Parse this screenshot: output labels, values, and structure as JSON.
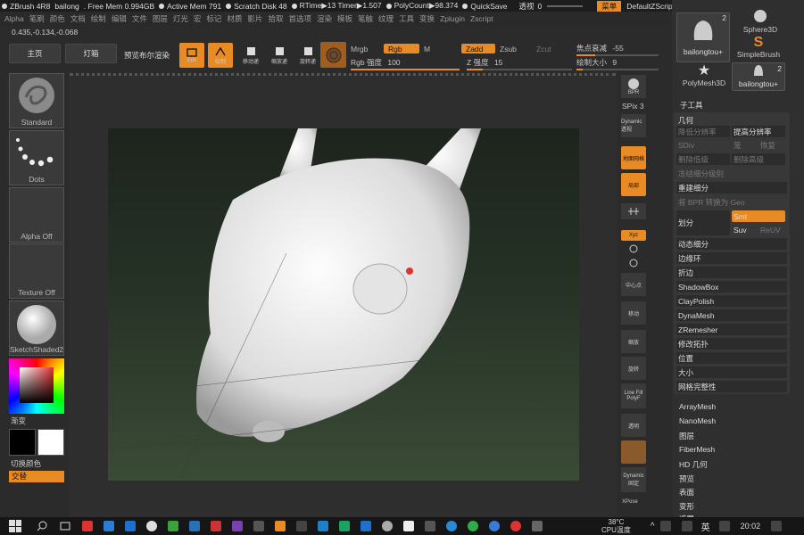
{
  "titlebar": {
    "items": [
      "ZBrush 4R8",
      "bailong",
      ". Free Mem 0.994GB",
      "Active Mem 791",
      "Scratch Disk 48",
      "RTime▶13 Timer▶1.507",
      "PolyCount▶98.374",
      "QuickSave"
    ],
    "transparency_label": "透视",
    "transparency_value": "0",
    "menu_label": "菜单",
    "script_label": "DefaultZScript"
  },
  "menubar": [
    "Alpha",
    "笔刷",
    "颜色",
    "文档",
    "绘制",
    "编辑",
    "文件",
    "图层",
    "灯光",
    "宏",
    "标记",
    "材质",
    "影片",
    "拾取",
    "首选项",
    "渲染",
    "模板",
    "笔触",
    "纹理",
    "工具",
    "变换",
    "Zplugin",
    "Zscript"
  ],
  "coords": "0.435,-0.134,-0.068",
  "toolbar": {
    "home": "主页",
    "lightbox": "灯箱",
    "bpr_preview": "预览布尔渲染",
    "edit": "Edit",
    "draw": "绘制",
    "move": "移动递",
    "scale": "缩放递",
    "rotate": "旋转递",
    "mrgb": "Mrgb",
    "rgb": "Rgb",
    "m": "M",
    "zadd": "Zadd",
    "zsub": "Zsub",
    "zcut": "Zcut",
    "rgb_intensity_label": "Rgb 强度",
    "rgb_intensity_value": "100",
    "z_intensity_label": "Z 强度",
    "z_intensity_value": "15",
    "focal_label": "焦点衰减",
    "focal_value": "-55",
    "draw_size_label": "绘制大小",
    "draw_size_value": "9"
  },
  "leftcol": {
    "tiles": [
      "Standard",
      "Dots",
      "Alpha Off",
      "Texture Off",
      "SketchShaded2"
    ],
    "gradient_label": "渐变",
    "switch_color": "切换颜色",
    "alternate": "交替"
  },
  "rightshelf": {
    "buttons": [
      "BPR",
      "SPix 3",
      "Dynamic\n透视",
      "地面网格",
      "局部",
      "Xyz",
      "",
      "",
      "中心点",
      "移动",
      "缩放",
      "旋转",
      "Line Fill\nPolyF",
      "透明",
      "Dynamic\n固定",
      "XPose"
    ]
  },
  "rpanel": {
    "subtools": [
      {
        "label": "bailongtou+",
        "count": "2"
      },
      {
        "label": "Sphere3D"
      },
      {
        "label": "SimpleBrush"
      },
      {
        "label": "PolyMesh3D"
      },
      {
        "label": "bailongtou+",
        "count": "2"
      }
    ],
    "subtool_title": "子工具",
    "geometry_title": "几何",
    "rows": {
      "lower_res": "降低分辨率",
      "higher_res": "提高分辨率",
      "sdiv": "SDiv",
      "cage": "笼",
      "rstr": "恢复",
      "del_lower": "删除低级",
      "del_higher": "删除高级",
      "freeze_sub": "冻结细分级别",
      "reconstruct": "重建细分",
      "bpr_geo": "将 BPR 转换为 Geo",
      "divide": "划分",
      "smt": "Smt",
      "suv": "Suv",
      "reuv": "ReUV"
    },
    "geo_list": [
      "动态细分",
      "边缘环",
      "折边",
      "ShadowBox",
      "ClayPolish",
      "DynaMesh",
      "ZRemesher",
      "修改拓扑",
      "位置",
      "大小",
      "网格完整性"
    ],
    "tool_list": [
      "ArrayMesh",
      "NanoMesh",
      "图层",
      "FiberMesh",
      "HD 几何",
      "预览",
      "表面",
      "变形",
      "遮罩"
    ]
  },
  "taskbar": {
    "temp": "38°C",
    "cpu": "CPU温度",
    "ime": "英",
    "time": "20:02"
  },
  "colors": {
    "accent": "#e98b25",
    "bg": "#2b2b2b",
    "panel": "#383838"
  }
}
